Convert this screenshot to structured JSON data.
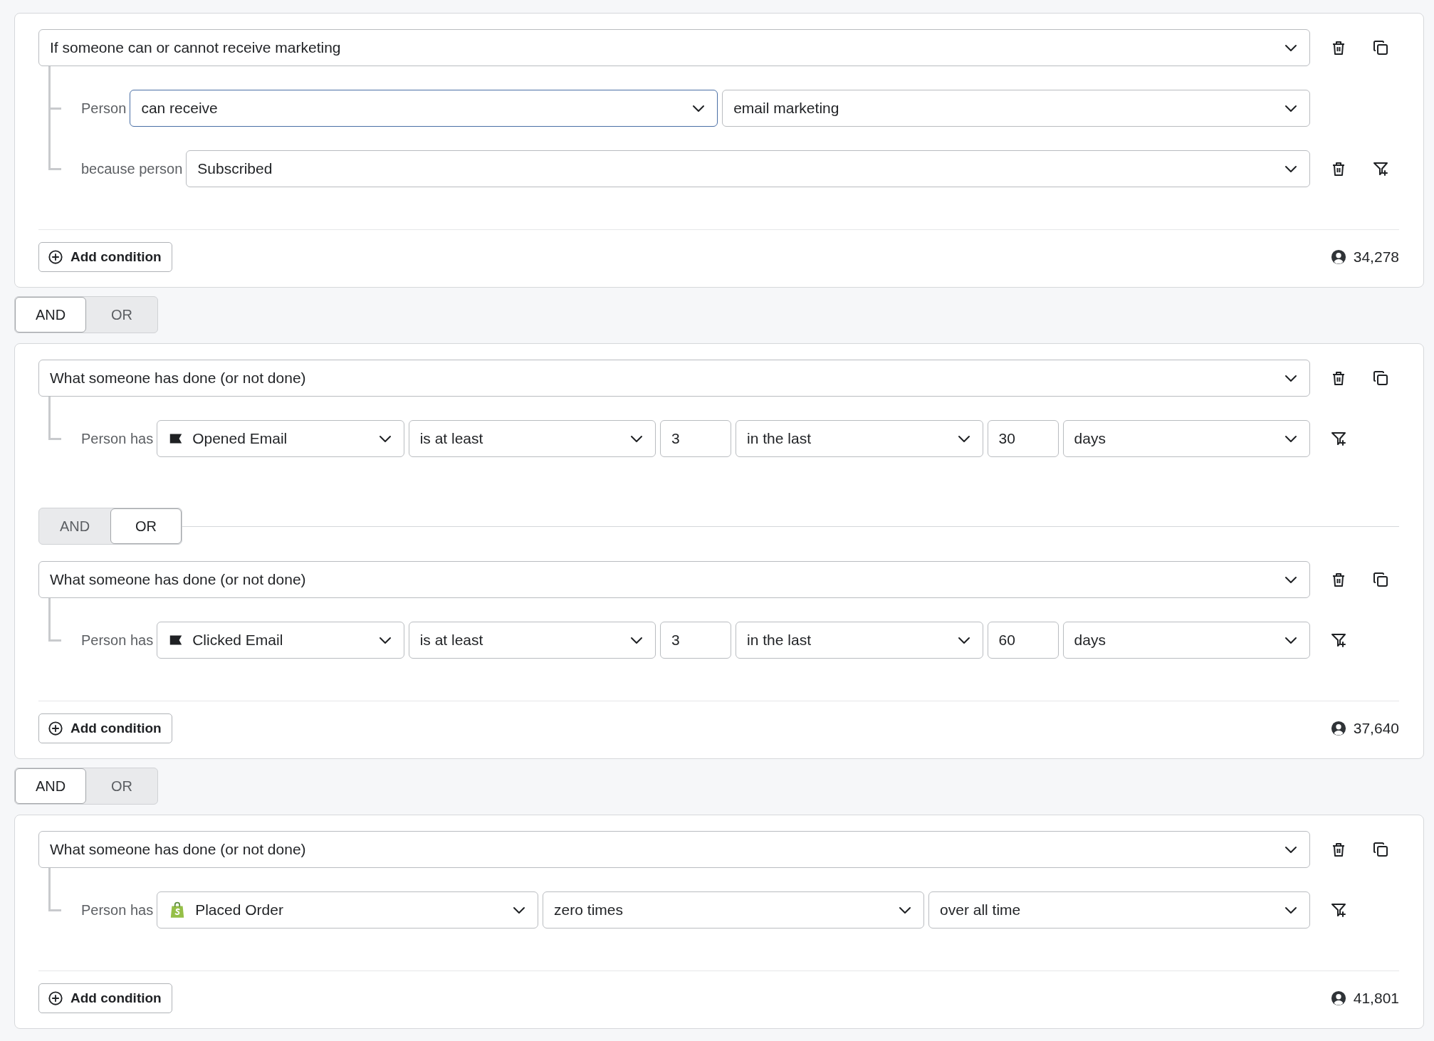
{
  "groups": [
    {
      "conditions": [
        {
          "header": "If someone can or cannot receive marketing",
          "header_actions": [
            {
              "kind": "delete"
            },
            {
              "kind": "copy"
            }
          ],
          "rows": [
            {
              "label": "Person",
              "fields": [
                {
                  "kind": "select",
                  "value": "can receive",
                  "focused": true
                },
                {
                  "kind": "select",
                  "value": "email marketing",
                  "focused": false
                }
              ],
              "actions": []
            },
            {
              "label": "because person",
              "fields": [
                {
                  "kind": "select",
                  "value": "Subscribed",
                  "focused": false
                }
              ],
              "actions": [
                {
                  "kind": "delete"
                },
                {
                  "kind": "filter"
                }
              ]
            }
          ]
        }
      ],
      "add_label": "Add condition",
      "count": "34,278"
    },
    {
      "joiner": [
        {
          "label": "AND",
          "selected": true
        },
        {
          "label": "OR",
          "selected": false
        }
      ],
      "conditions": [
        {
          "header": "What someone has done (or not done)",
          "header_actions": [
            {
              "kind": "delete"
            },
            {
              "kind": "copy"
            }
          ],
          "rows": [
            {
              "label": "Person has",
              "fields": [
                {
                  "kind": "email-event",
                  "value": "Opened Email",
                  "focused": false
                },
                {
                  "kind": "select",
                  "value": "is at least",
                  "focused": false
                },
                {
                  "kind": "input",
                  "value": "3"
                },
                {
                  "kind": "select",
                  "value": "in the last",
                  "focused": false
                },
                {
                  "kind": "input",
                  "value": "30"
                },
                {
                  "kind": "select",
                  "value": "days",
                  "focused": false
                }
              ],
              "actions": [
                {
                  "kind": "filter"
                }
              ]
            }
          ]
        },
        {
          "joiner": [
            {
              "label": "AND",
              "selected": false
            },
            {
              "label": "OR",
              "selected": true
            }
          ],
          "header": "What someone has done (or not done)",
          "header_actions": [
            {
              "kind": "delete"
            },
            {
              "kind": "copy"
            }
          ],
          "rows": [
            {
              "label": "Person has",
              "fields": [
                {
                  "kind": "email-event",
                  "value": "Clicked Email",
                  "focused": false
                },
                {
                  "kind": "select",
                  "value": "is at least",
                  "focused": false
                },
                {
                  "kind": "input",
                  "value": "3"
                },
                {
                  "kind": "select",
                  "value": "in the last",
                  "focused": false
                },
                {
                  "kind": "input",
                  "value": "60"
                },
                {
                  "kind": "select",
                  "value": "days",
                  "focused": false
                }
              ],
              "actions": [
                {
                  "kind": "filter"
                }
              ]
            }
          ]
        }
      ],
      "add_label": "Add condition",
      "count": "37,640"
    },
    {
      "joiner": [
        {
          "label": "AND",
          "selected": true
        },
        {
          "label": "OR",
          "selected": false
        }
      ],
      "conditions": [
        {
          "header": "What someone has done (or not done)",
          "header_actions": [
            {
              "kind": "delete"
            },
            {
              "kind": "copy"
            }
          ],
          "rows": [
            {
              "label": "Person has",
              "fields": [
                {
                  "kind": "shop-event",
                  "value": "Placed Order",
                  "focused": false
                },
                {
                  "kind": "select",
                  "value": "zero times",
                  "focused": false
                },
                {
                  "kind": "select",
                  "value": "over all time",
                  "focused": false
                }
              ],
              "actions": [
                {
                  "kind": "filter"
                }
              ]
            }
          ]
        }
      ],
      "add_label": "Add condition",
      "count": "41,801"
    }
  ]
}
